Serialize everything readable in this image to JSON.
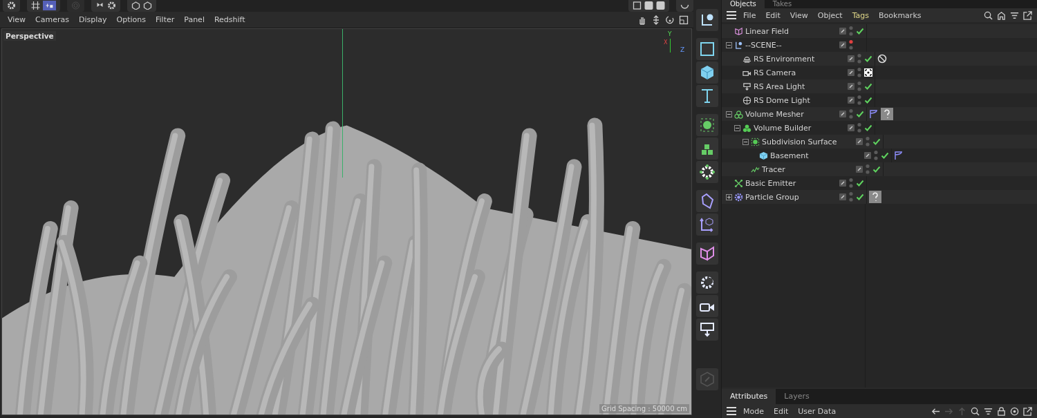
{
  "viewport": {
    "menu": [
      {
        "label": "View"
      },
      {
        "label": "Cameras"
      },
      {
        "label": "Display"
      },
      {
        "label": "Options"
      },
      {
        "label": "Filter"
      },
      {
        "label": "Panel"
      },
      {
        "label": "Redshift"
      }
    ],
    "camera_label": "Perspective",
    "axis_labels": [
      "Y",
      "X",
      "Z"
    ],
    "grid_spacing": "Grid Spacing : 50000 cm"
  },
  "object_manager": {
    "tabs": [
      {
        "label": "Objects",
        "selected": true
      },
      {
        "label": "Takes",
        "selected": false
      }
    ],
    "menu": [
      {
        "label": "File",
        "selected": false
      },
      {
        "label": "Edit",
        "selected": false
      },
      {
        "label": "View",
        "selected": false
      },
      {
        "label": "Object",
        "selected": false
      },
      {
        "label": "Tags",
        "selected": true
      },
      {
        "label": "Bookmarks",
        "selected": false
      }
    ],
    "objects": [
      {
        "name": "Linear Field",
        "kind": "field",
        "editor_off": false,
        "render_on": true
      },
      {
        "name": "--SCENE--",
        "kind": "null",
        "editor_off": true,
        "render_on": false,
        "expanded": true,
        "children": [
          {
            "name": "RS Environment",
            "kind": "environment",
            "editor_off": false,
            "render_on": true,
            "tags": [
              {
                "kind": "forbidden"
              }
            ]
          },
          {
            "name": "RS Camera",
            "kind": "camera",
            "editor_off": false,
            "render_on": true
          },
          {
            "name": "RS Area Light",
            "kind": "area-light",
            "editor_off": false,
            "render_on": true
          },
          {
            "name": "RS Dome Light",
            "kind": "dome-light",
            "editor_off": false,
            "render_on": true
          }
        ]
      },
      {
        "name": "Volume Mesher",
        "kind": "volume-mesher",
        "editor_off": false,
        "render_on": true,
        "tags": [
          {
            "kind": "phong"
          },
          {
            "kind": "material"
          }
        ],
        "expanded": true,
        "children": [
          {
            "name": "Volume Builder",
            "kind": "volume-builder",
            "editor_off": false,
            "render_on": true,
            "expanded": true,
            "children": [
              {
                "name": "Subdivision Surface",
                "kind": "subdivision",
                "editor_off": false,
                "render_on": true,
                "expanded": true,
                "children": [
                  {
                    "name": "Basement",
                    "kind": "cube",
                    "editor_off": false,
                    "render_on": true,
                    "tags": [
                      {
                        "kind": "phong"
                      }
                    ]
                  }
                ]
              },
              {
                "name": "Tracer",
                "kind": "tracer",
                "editor_off": false,
                "render_on": true
              }
            ]
          }
        ]
      },
      {
        "name": "Basic Emitter",
        "kind": "emitter",
        "editor_off": false,
        "render_on": true
      },
      {
        "name": "Particle Group",
        "kind": "particle-group",
        "editor_off": false,
        "render_on": true,
        "tags": [
          {
            "kind": "material"
          }
        ],
        "expanded": false
      }
    ]
  },
  "attribute_manager": {
    "tabs": [
      {
        "label": "Attributes",
        "selected": true
      },
      {
        "label": "Layers",
        "selected": false
      }
    ],
    "menu": [
      {
        "label": "Mode"
      },
      {
        "label": "Edit"
      },
      {
        "label": "User Data"
      }
    ]
  }
}
